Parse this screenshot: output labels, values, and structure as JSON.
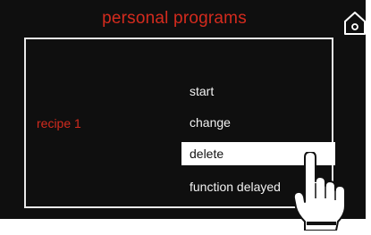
{
  "header": {
    "title": "personal programs"
  },
  "recipe": {
    "label": "recipe 1"
  },
  "menu": {
    "items": [
      {
        "label": "start",
        "selected": false
      },
      {
        "label": "change",
        "selected": false
      },
      {
        "label": "delete",
        "selected": true
      },
      {
        "label": "function delayed",
        "selected": false
      }
    ]
  },
  "icons": {
    "home": "home-icon",
    "pointer": "hand-pointer-icon"
  },
  "colors": {
    "background": "#0f0f0f",
    "accent_red": "#d42b1e",
    "text": "#f2f2f2",
    "selected_bg": "#ffffff"
  }
}
